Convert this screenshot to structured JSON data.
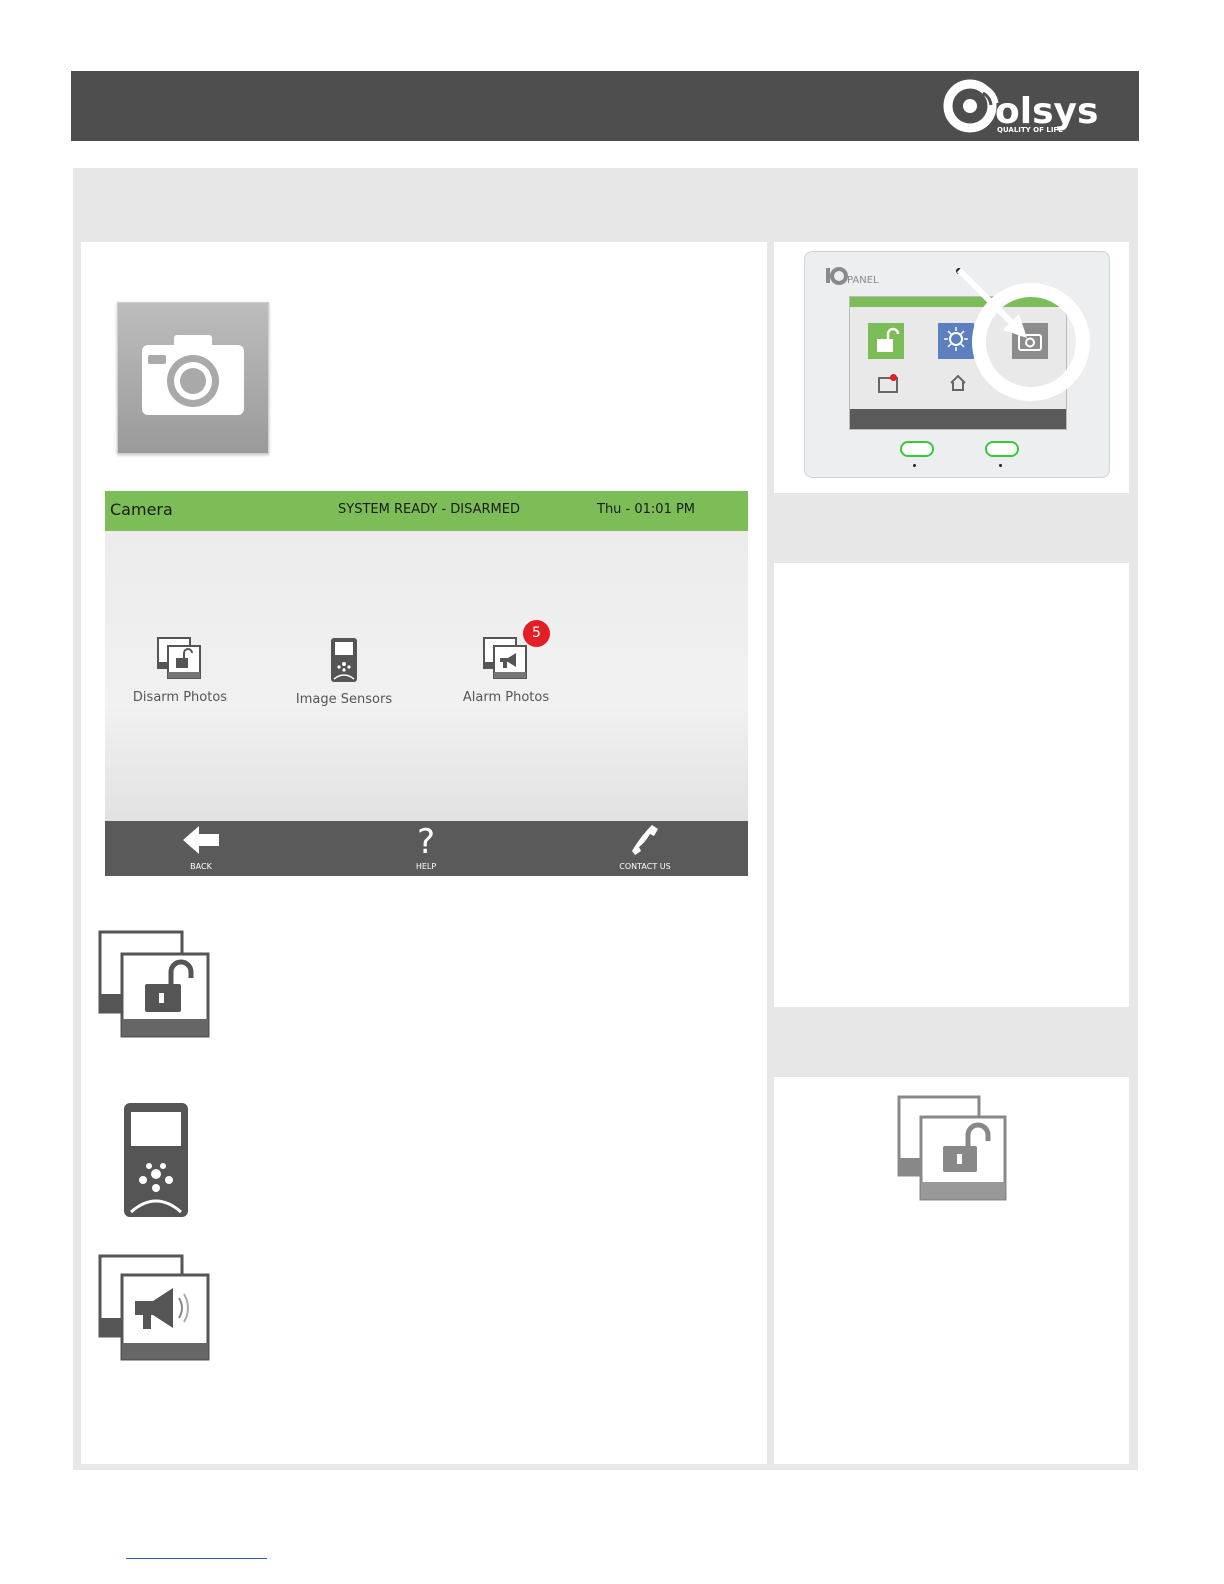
{
  "header": {
    "logo_text": "olsys",
    "logo_tagline": "QUALITY OF LIFE"
  },
  "screen": {
    "title": "Camera",
    "status": "SYSTEM READY - DISARMED",
    "time": "Thu - 01:01 PM",
    "tiles": [
      {
        "label": "Disarm Photos",
        "icon": "disarm-photos-icon"
      },
      {
        "label": "Image Sensors",
        "icon": "image-sensor-icon"
      },
      {
        "label": "Alarm Photos",
        "icon": "alarm-photos-icon",
        "badge": "5"
      }
    ],
    "nav": {
      "back": "BACK",
      "help": "HELP",
      "contact": "CONTACT US"
    }
  },
  "panel_preview": {
    "brand": "PANEL",
    "tiles": [
      "PRESS TO ARM",
      "WEATHER",
      "CAMERA/VIDEO",
      "STATUS",
      "HOME CONTROL"
    ],
    "colors": {
      "green": "#7cbd57",
      "dark": "#5a5a5a",
      "badge": "#e31e24"
    }
  }
}
